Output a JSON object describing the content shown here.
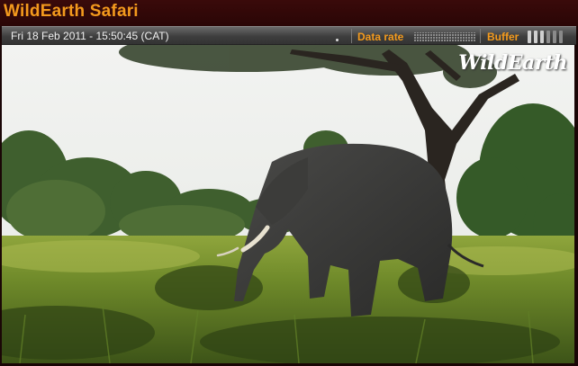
{
  "app": {
    "title": "WildEarth Safari"
  },
  "status": {
    "timestamp": "Fri 18 Feb 2011 - 15:50:45 (CAT)",
    "data_rate_label": "Data rate",
    "buffer_label": "Buffer",
    "buffer_level": 0.5
  },
  "video": {
    "watermark": "WildEarth"
  },
  "colors": {
    "accent": "#f39a1d",
    "titlebar": "#2a0606"
  }
}
